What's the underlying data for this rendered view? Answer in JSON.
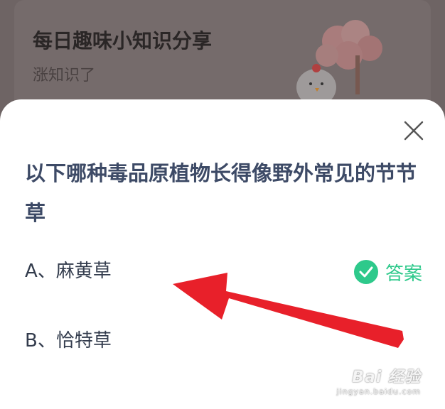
{
  "background": {
    "title": "每日趣味小知识分享",
    "subtitle": "涨知识了"
  },
  "quiz": {
    "question": "以下哪种毒品原植物长得像野外常见的节节草",
    "options": [
      {
        "label": "A、麻黄草",
        "is_answer": true
      },
      {
        "label": "B、恰特草",
        "is_answer": false
      }
    ],
    "answer_label": "答案"
  },
  "icons": {
    "close": "close-icon",
    "check": "check-circle-icon",
    "arrow": "red-arrow-annotation"
  },
  "colors": {
    "accent_green": "#2ec98b",
    "question_text": "#3d4a66",
    "arrow_red": "#e8202a"
  },
  "watermark": {
    "logo": "Bai 经验",
    "url": "jingyan.baidu.com"
  }
}
